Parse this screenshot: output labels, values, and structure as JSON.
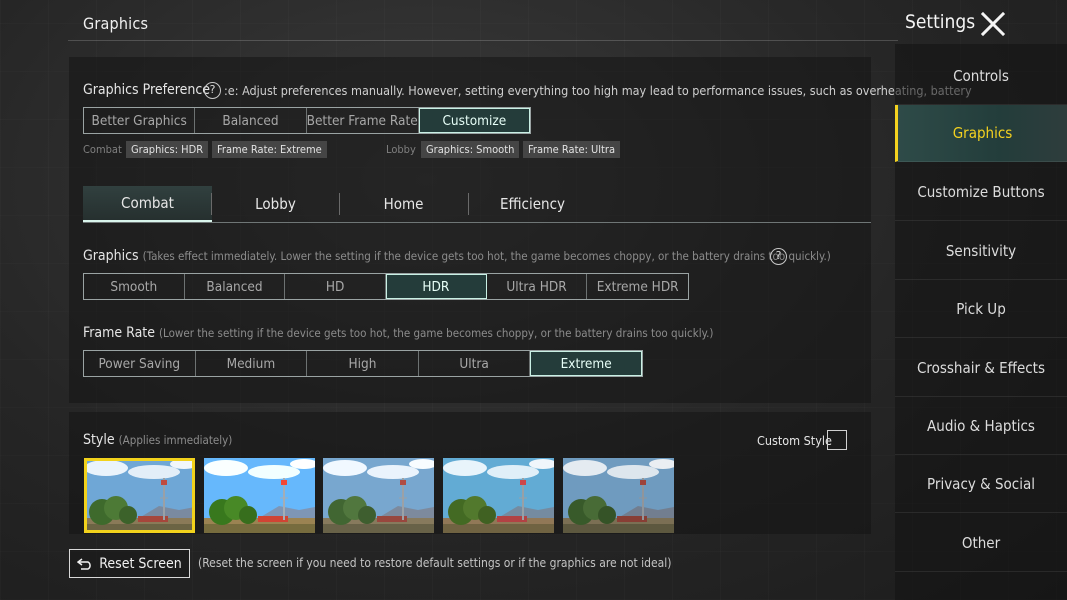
{
  "page": {
    "title": "Graphics"
  },
  "preference": {
    "label": "Graphics Preference",
    "help": "?",
    "description": ":e: Adjust preferences manually. However, setting everything too high may lead to performance issues, such as overheating, battery",
    "options": [
      "Better Graphics",
      "Balanced",
      "Better Frame Rate",
      "Customize"
    ],
    "selected": "Customize",
    "combat_label": "Combat",
    "combat_tags": [
      "Graphics: HDR",
      "Frame Rate: Extreme"
    ],
    "lobby_label": "Lobby",
    "lobby_tags": [
      "Graphics: Smooth",
      "Frame Rate: Ultra"
    ]
  },
  "tabs": {
    "items": [
      "Combat",
      "Lobby",
      "Home",
      "Efficiency"
    ],
    "selected": "Combat"
  },
  "graphics": {
    "label": "Graphics",
    "note": "(Takes effect immediately. Lower the setting if the device gets too hot, the game becomes choppy, or the battery drains too quickly.)",
    "help": "?",
    "options": [
      "Smooth",
      "Balanced",
      "HD",
      "HDR",
      "Ultra HDR",
      "Extreme HDR"
    ],
    "selected": "HDR"
  },
  "frame_rate": {
    "label": "Frame Rate",
    "note": "(Lower the setting if the device gets too hot, the game becomes choppy, or the battery drains too quickly.)",
    "options": [
      "Power Saving",
      "Medium",
      "High",
      "Ultra",
      "Extreme"
    ],
    "selected": "Extreme"
  },
  "style": {
    "label": "Style",
    "note": "(Applies immediately)",
    "custom_label": "Custom Style",
    "custom_checked": false,
    "thumbnails": 5,
    "selected_index": 0
  },
  "footer": {
    "reset_label": "Reset Screen",
    "reset_note": "(Reset the screen if you need to restore default settings or if the graphics are not ideal)"
  },
  "sidebar": {
    "title": "Settings",
    "items": [
      "Controls",
      "Graphics",
      "Customize Buttons",
      "Sensitivity",
      "Pick Up",
      "Crosshair & Effects",
      "Audio & Haptics",
      "Privacy & Social",
      "Other"
    ],
    "selected": "Graphics"
  },
  "colors": {
    "accent": "#f4d21f",
    "selected_bg": "#243c3a",
    "selected_border": "#c9f0e4"
  }
}
